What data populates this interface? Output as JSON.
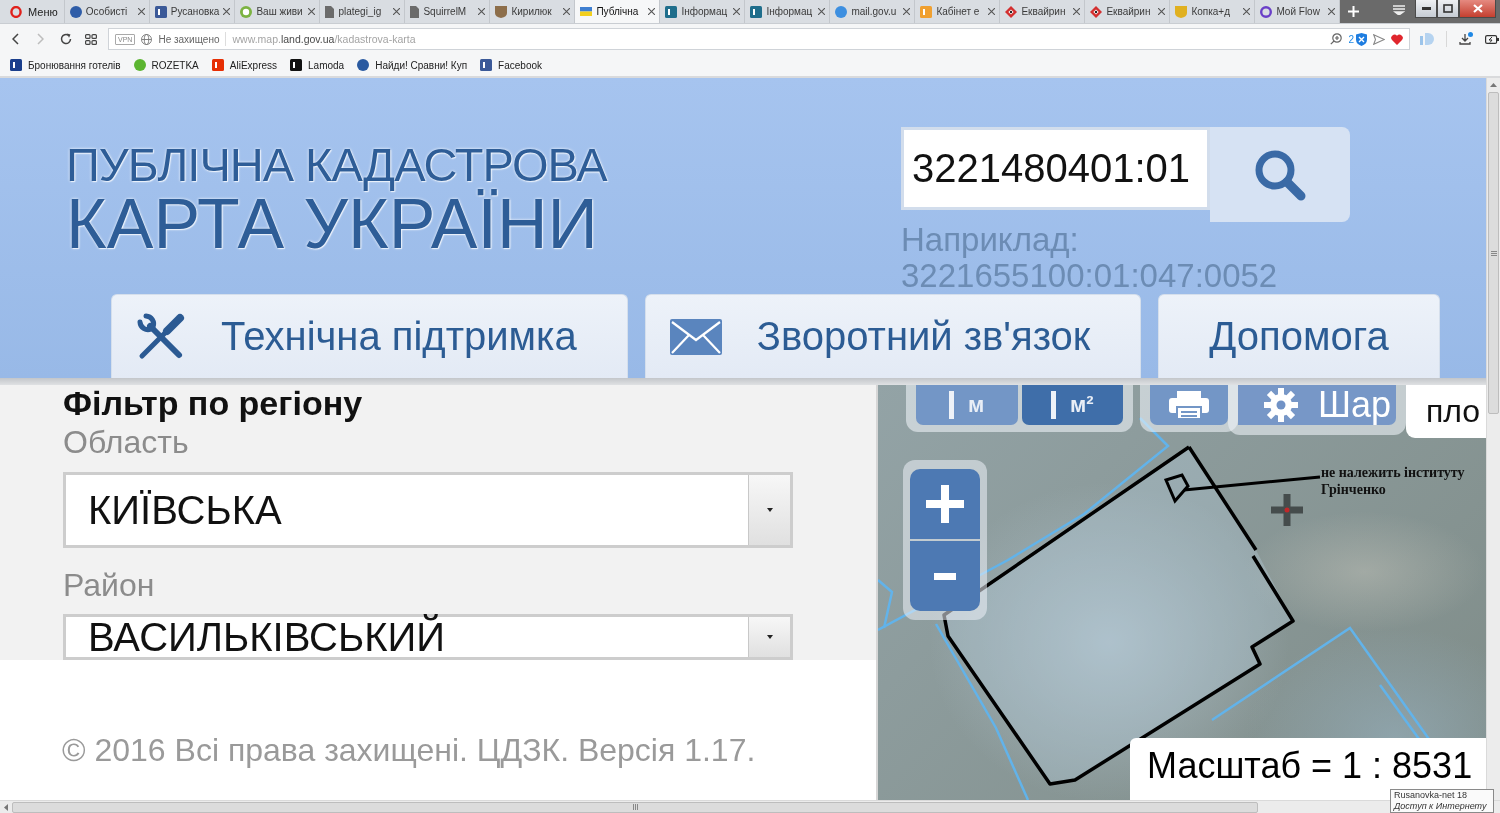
{
  "browser": {
    "menu_button": {
      "label": "Меню"
    },
    "tabs": [
      {
        "label": "Особисті",
        "kind": "disc",
        "color": "#2f5da8",
        "selected": false
      },
      {
        "label": "Русановка",
        "kind": "square",
        "color": "#3b5998",
        "selected": false
      },
      {
        "label": "Ваш живи",
        "kind": "outlined-disc",
        "color": "#7cb342",
        "selected": false
      },
      {
        "label": "plategi_ig",
        "kind": "document",
        "color": "#6b6b6b",
        "selected": false
      },
      {
        "label": "SquirrelM",
        "kind": "document",
        "color": "#6b6b6b",
        "selected": false
      },
      {
        "label": "Кирилюк",
        "kind": "emblem",
        "color": "#8d6e4a",
        "selected": false
      },
      {
        "label": "Публічна",
        "kind": "flag",
        "color": "#3f7fd0",
        "selected": true
      },
      {
        "label": "Інформац",
        "kind": "square",
        "color": "#1f6e8c",
        "selected": false
      },
      {
        "label": "Інформац",
        "kind": "square",
        "color": "#1f6e8c",
        "selected": false
      },
      {
        "label": "mail.gov.u",
        "kind": "disc",
        "color": "#3d8fe0",
        "selected": false
      },
      {
        "label": "Кабінет е",
        "kind": "square",
        "color": "#f0a030",
        "selected": false
      },
      {
        "label": "Еквайрин",
        "kind": "diamond",
        "color": "#d32f2f",
        "selected": false
      },
      {
        "label": "Еквайрин",
        "kind": "diamond",
        "color": "#d32f2f",
        "selected": false
      },
      {
        "label": "Копка+д",
        "kind": "emblem",
        "color": "#e0b020",
        "selected": false
      },
      {
        "label": "Мой Flow",
        "kind": "ring",
        "color": "#6a3fc8",
        "selected": false
      }
    ],
    "address_bar": {
      "forward_disabled": true,
      "vpn": "VPN",
      "security": "Не захищено",
      "url": "www.map.**land.gov.ua**/kadastrova-karta",
      "badge_count": "2"
    },
    "bookmarks": [
      {
        "label": "Бронювання готелів",
        "kind": "square",
        "color": "#1a3e8c"
      },
      {
        "label": "ROZETKA",
        "kind": "disc",
        "color": "#5cb531"
      },
      {
        "label": "AliExpress",
        "kind": "square",
        "color": "#e62e04"
      },
      {
        "label": "Lamoda",
        "kind": "square",
        "color": "#111111"
      },
      {
        "label": "Найди! Сравни! Куп",
        "kind": "disc",
        "color": "#2a5aa0"
      },
      {
        "label": "Facebook",
        "kind": "square",
        "color": "#3b5998"
      }
    ]
  },
  "header": {
    "title": [
      "ПУБЛІЧНА КАДАСТРОВА",
      "КАРТА УКРАЇНИ"
    ],
    "search": {
      "value": "3221480401:01"
    },
    "example": {
      "label": "Наприклад:",
      "value": "3221655100:01:047:0052"
    }
  },
  "nav": [
    {
      "label": "Технічна підтримка",
      "kind": "tools"
    },
    {
      "label": "Зворотний зв'язок",
      "kind": "envelope"
    },
    {
      "label": "Допомога",
      "kind": "text"
    }
  ],
  "filter": {
    "heading": "Фільтр по регіону",
    "fields": [
      {
        "label": "Область",
        "value": "КИЇВСЬКА"
      },
      {
        "label": "Район",
        "value": "ВАСИЛЬКІВСЬКИЙ"
      }
    ]
  },
  "footer": {
    "copyright": "© 2016 Всі права захищені. ЦДЗК. Версія 1.17."
  },
  "map": {
    "measure_tools": [
      {
        "label": "м",
        "selected": false
      },
      {
        "label": "м²",
        "selected": true
      }
    ],
    "layers_button": {
      "label": "Шар"
    },
    "info_panel": {
      "text": "пло"
    },
    "annotation": [
      "не належить інституту",
      "Грінченко"
    ],
    "scale": "Масштаб = 1 : 8531"
  },
  "tooltip": {
    "network": "Rusanovka-net 18",
    "status": "Доступ к Интернету"
  }
}
